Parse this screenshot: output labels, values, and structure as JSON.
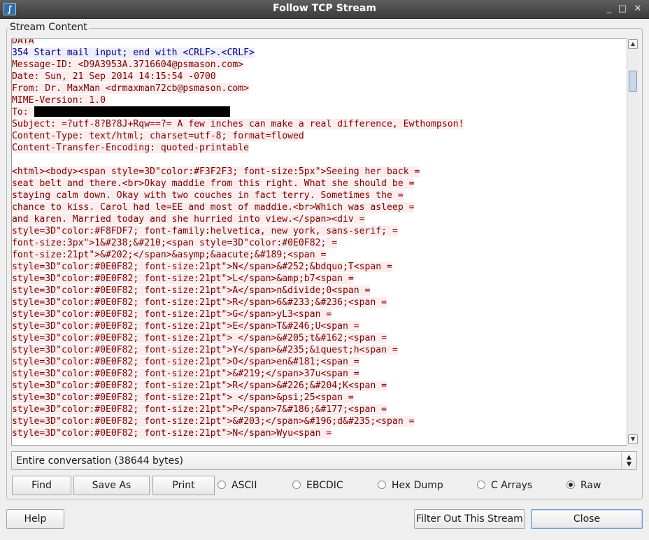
{
  "window": {
    "title": "Follow TCP Stream",
    "app_icon": "wireshark-fin-icon",
    "controls": {
      "minimize": "_",
      "maximize": "□",
      "close": "✕"
    }
  },
  "group": {
    "label": "Stream Content"
  },
  "stream": {
    "redacted_text": "████████████████████",
    "lines": [
      {
        "text": "DATA",
        "side": "client"
      },
      {
        "text": "354 Start mail input; end with <CRLF>.<CRLF>",
        "side": "server"
      },
      {
        "text": "Message-ID: <D9A3953A.3716604@psmason.com>",
        "side": "client"
      },
      {
        "text": "Date: Sun, 21 Sep 2014 14:15:54 -0700",
        "side": "client"
      },
      {
        "text": "From: Dr. MaxMan <drmaxman72cb@psmason.com>",
        "side": "client"
      },
      {
        "text": "MIME-Version: 1.0",
        "side": "client"
      },
      {
        "text": "To: ",
        "side": "client",
        "redacted": true
      },
      {
        "text": "Subject: =?utf-8?B?8J+Rqw==?= A few inches can make a real difference, Ewthompson!",
        "side": "client"
      },
      {
        "text": "Content-Type: text/html; charset=utf-8; format=flowed",
        "side": "client"
      },
      {
        "text": "Content-Transfer-Encoding: quoted-printable",
        "side": "client"
      },
      {
        "text": "",
        "side": "none"
      },
      {
        "text": "<html><body><span style=3D\"color:#F3F2F3; font-size:5px\">Seeing her back =",
        "side": "client"
      },
      {
        "text": "seat belt and there.<br>Okay maddie from this right. What she should be =",
        "side": "client"
      },
      {
        "text": "staying calm down. Okay with two couches in fact terry. Sometimes the =",
        "side": "client"
      },
      {
        "text": "chance to kiss. Carol had le=EE and most of maddie.<br>Which was asleep =",
        "side": "client"
      },
      {
        "text": "and karen. Married today and she hurried into view.</span><div =",
        "side": "client"
      },
      {
        "text": "style=3D\"color:#F8FDF7; font-family:helvetica, new york, sans-serif; =",
        "side": "client"
      },
      {
        "text": "font-size:3px\">1&#238;&#210;<span style=3D\"color:#0E0F82; =",
        "side": "client"
      },
      {
        "text": "font-size:21pt\">&#202;</span>&asymp;&aacute;&#189;<span =",
        "side": "client"
      },
      {
        "text": "style=3D\"color:#0E0F82; font-size:21pt\">N</span>&#252;&bdquo;T<span =",
        "side": "client"
      },
      {
        "text": "style=3D\"color:#0E0F82; font-size:21pt\">L</span>&amp;b7<span =",
        "side": "client"
      },
      {
        "text": "style=3D\"color:#0E0F82; font-size:21pt\">A</span>n&divide;0<span =",
        "side": "client"
      },
      {
        "text": "style=3D\"color:#0E0F82; font-size:21pt\">R</span>6&#233;&#236;<span =",
        "side": "client"
      },
      {
        "text": "style=3D\"color:#0E0F82; font-size:21pt\">G</span>yL3<span =",
        "side": "client"
      },
      {
        "text": "style=3D\"color:#0E0F82; font-size:21pt\">E</span>T&#246;U<span =",
        "side": "client"
      },
      {
        "text": "style=3D\"color:#0E0F82; font-size:21pt\"> </span>&#205;t&#162;<span =",
        "side": "client"
      },
      {
        "text": "style=3D\"color:#0E0F82; font-size:21pt\">Y</span>&#235;&iquest;h<span =",
        "side": "client"
      },
      {
        "text": "style=3D\"color:#0E0F82; font-size:21pt\">O</span>en&#181;<span =",
        "side": "client"
      },
      {
        "text": "style=3D\"color:#0E0F82; font-size:21pt\">&#219;</span>37u<span =",
        "side": "client"
      },
      {
        "text": "style=3D\"color:#0E0F82; font-size:21pt\">R</span>&#226;&#204;K<span =",
        "side": "client"
      },
      {
        "text": "style=3D\"color:#0E0F82; font-size:21pt\"> </span>&psi;25<span =",
        "side": "client"
      },
      {
        "text": "style=3D\"color:#0E0F82; font-size:21pt\">P</span>7&#186;&#177;<span =",
        "side": "client"
      },
      {
        "text": "style=3D\"color:#0E0F82; font-size:21pt\">&#203;</span>&#196;d&#235;<span =",
        "side": "client"
      },
      {
        "text": "style=3D\"color:#0E0F82; font-size:21pt\">N</span>Wyu<span =",
        "side": "client"
      }
    ]
  },
  "conversation_select": {
    "value": "Entire conversation (38644 bytes)"
  },
  "buttons": {
    "find": "Find",
    "save_as": "Save As",
    "print": "Print"
  },
  "encoding": {
    "options": [
      "ASCII",
      "EBCDIC",
      "Hex Dump",
      "C Arrays",
      "Raw"
    ],
    "selected": "Raw"
  },
  "footer": {
    "help": "Help",
    "filter_out": "Filter Out This Stream",
    "close": "Close"
  },
  "colors": {
    "client_bg": "#fbeded",
    "client_fg": "#7f0000",
    "server_bg": "#ededfb",
    "server_fg": "#00007f"
  }
}
